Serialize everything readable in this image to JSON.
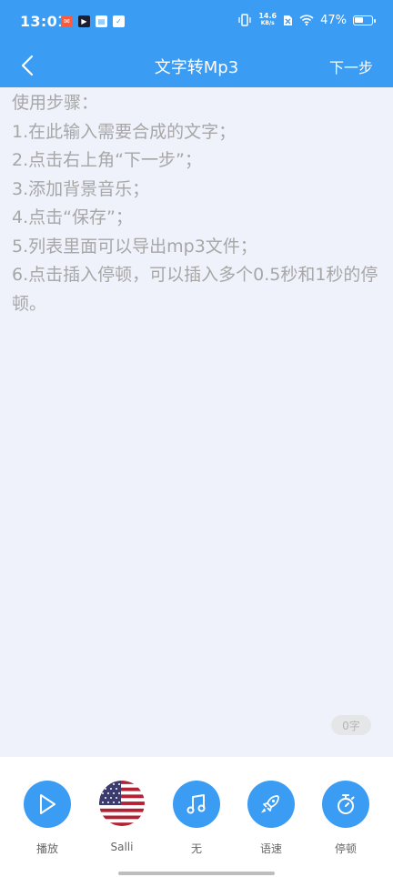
{
  "status_bar": {
    "time": "13:01",
    "net_speed_value": "14.6",
    "net_speed_unit": "KB/s",
    "battery_percent": "47%"
  },
  "app_bar": {
    "title": "文字转Mp3",
    "next_label": "下一步"
  },
  "editor": {
    "placeholder_lines": [
      "使用步骤：",
      "1.在此输入需要合成的文字；",
      "2.点击右上角“下一步”；",
      "3.添加背景音乐；",
      "4.点击“保存”；",
      "5.列表里面可以导出mp3文件；",
      "6.点击插入停顿，可以插入多个0.5秒和1秒的停顿。"
    ],
    "char_count": "0字"
  },
  "toolbar": {
    "items": [
      {
        "label": "播放",
        "icon": "play-icon"
      },
      {
        "label": "Salli",
        "icon": "us-flag-icon"
      },
      {
        "label": "无",
        "icon": "music-note-icon"
      },
      {
        "label": "语速",
        "icon": "rocket-icon"
      },
      {
        "label": "停顿",
        "icon": "stopwatch-icon"
      }
    ]
  },
  "colors": {
    "primary": "#3b9cf3",
    "editor_bg": "#eff2fb",
    "placeholder_text": "#a7a7a7"
  }
}
